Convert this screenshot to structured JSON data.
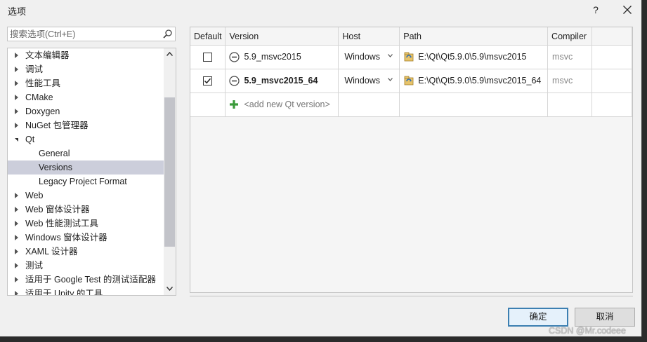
{
  "window": {
    "title": "选项",
    "help_label": "?"
  },
  "search": {
    "placeholder": "搜索选项(Ctrl+E)"
  },
  "tree": {
    "items": [
      {
        "label": "文本编辑器",
        "expandable": true
      },
      {
        "label": "调试",
        "expandable": true
      },
      {
        "label": "性能工具",
        "expandable": true
      },
      {
        "label": "CMake",
        "expandable": true
      },
      {
        "label": "Doxygen",
        "expandable": true
      },
      {
        "label": "NuGet 包管理器",
        "expandable": true
      },
      {
        "label": "Qt",
        "expanded": true
      },
      {
        "label": "General",
        "child": true
      },
      {
        "label": "Versions",
        "child": true,
        "selected": true
      },
      {
        "label": "Legacy Project Format",
        "child": true
      },
      {
        "label": "Web",
        "expandable": true
      },
      {
        "label": "Web 窗体设计器",
        "expandable": true
      },
      {
        "label": "Web 性能测试工具",
        "expandable": true
      },
      {
        "label": "Windows 窗体设计器",
        "expandable": true
      },
      {
        "label": "XAML 设计器",
        "expandable": true
      },
      {
        "label": "测试",
        "expandable": true
      },
      {
        "label": "适用于 Google Test 的测试适配器",
        "expandable": true
      },
      {
        "label": "适用于 Unity 的工具",
        "expandable": true
      }
    ]
  },
  "grid": {
    "headers": {
      "default": "Default",
      "version": "Version",
      "host": "Host",
      "path": "Path",
      "compiler": "Compiler"
    },
    "rows": [
      {
        "default_checked": false,
        "version": "5.9_msvc2015",
        "bold": false,
        "host": "Windows",
        "path": "E:\\Qt\\Qt5.9.0\\5.9\\msvc2015",
        "compiler": "msvc"
      },
      {
        "default_checked": true,
        "version": "5.9_msvc2015_64",
        "bold": true,
        "host": "Windows",
        "path": "E:\\Qt\\Qt5.9.0\\5.9\\msvc2015_64",
        "compiler": "msvc"
      }
    ],
    "add_row_label": "<add new Qt version>"
  },
  "buttons": {
    "ok": "确定",
    "cancel": "取消"
  },
  "watermark": "CSDN @Mr.codeee",
  "colors": {
    "selected_bg": "#cccedb",
    "ok_border": "#3c7fb1",
    "add_green": "#3a9a3a"
  }
}
